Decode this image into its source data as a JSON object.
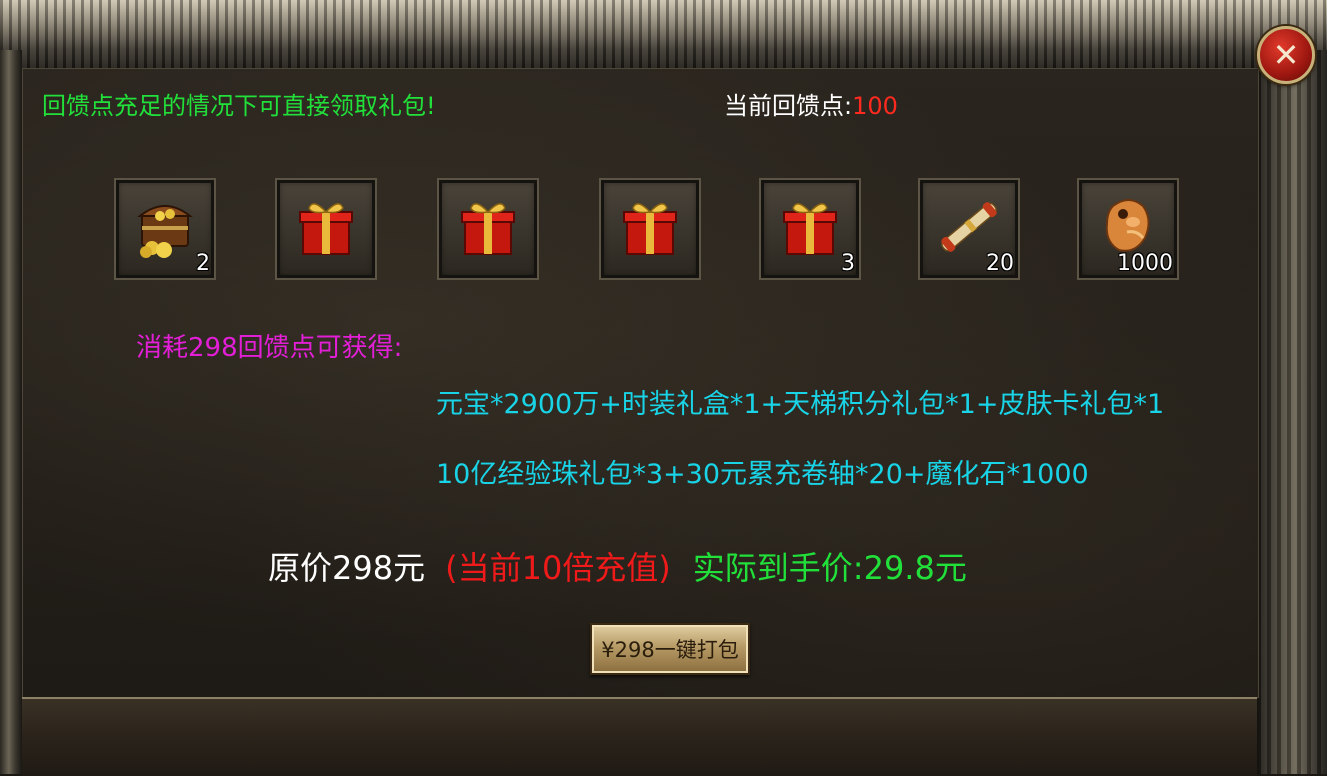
{
  "close_icon_glyph": "✕",
  "notice": "回馈点充足的情况下可直接领取礼包!",
  "points": {
    "label": "当前回馈点:",
    "value": "100"
  },
  "items": [
    {
      "icon": "treasure-chest-icon",
      "count": "2"
    },
    {
      "icon": "gift-box-icon",
      "count": ""
    },
    {
      "icon": "gift-box-icon",
      "count": ""
    },
    {
      "icon": "gift-box-icon",
      "count": ""
    },
    {
      "icon": "gift-box-icon",
      "count": "3"
    },
    {
      "icon": "scroll-icon",
      "count": "20"
    },
    {
      "icon": "magic-stone-icon",
      "count": "1000"
    }
  ],
  "cost_text": "消耗298回馈点可获得:",
  "rewards": {
    "line1": "元宝*2900万+时装礼盒*1+天梯积分礼包*1+皮肤卡礼包*1",
    "line2": "10亿经验珠礼包*3+30元累充卷轴*20+魔化石*1000"
  },
  "price": {
    "original": "原价298元",
    "multiplier": "(当前10倍充值)",
    "actual": "实际到手价:29.8元"
  },
  "button": {
    "label": "¥298一键打包"
  },
  "colors": {
    "notice_green": "#22e03a",
    "points_red": "#ff2a1f",
    "cost_magenta": "#e21fd6",
    "reward_cyan": "#19d3e6",
    "multiplier_red": "#f01a1a"
  }
}
